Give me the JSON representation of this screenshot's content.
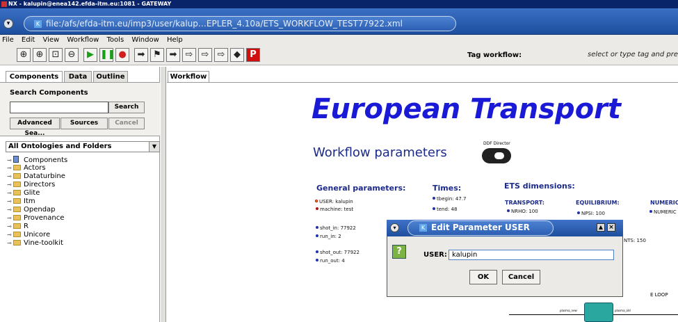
{
  "window": {
    "title": "NX - kalupin@enea142.efda-itm.eu:1081 - GATEWAY"
  },
  "address": {
    "k_badge": "K",
    "path": "file:/afs/efda-itm.eu/imp3/user/kalup…EPLER_4.10a/ETS_WORKFLOW_TEST77922.xml"
  },
  "menu": [
    "File",
    "Edit",
    "View",
    "Workflow",
    "Tools",
    "Window",
    "Help"
  ],
  "toolbar": {
    "buttons": [
      "zoom-in-icon",
      "zoom-reset-icon",
      "zoom-fit-icon",
      "zoom-out-icon",
      "run-icon",
      "pause-icon",
      "stop-icon",
      "arrow-right-icon",
      "flag-icon",
      "arrow-right-bar-icon",
      "outline-arrow-icon",
      "outline-arrow-2-icon",
      "outline-arrow-3-icon",
      "diamond-icon",
      "p-icon"
    ],
    "glyphs": [
      "⊕",
      "⊕",
      "⊡",
      "⊖",
      "▶",
      "❚❚",
      "●",
      "➡",
      "⚑",
      "➡",
      "⇨",
      "⇨",
      "⇨",
      "◆",
      "P"
    ],
    "tag_label": "Tag workflow:",
    "tag_placeholder": "select or type tag and press"
  },
  "left_tabs": [
    "Components",
    "Data",
    "Outline"
  ],
  "search": {
    "title": "Search Components",
    "search_btn": "Search",
    "advanced_btn": "Advanced Sea...",
    "sources_btn": "Sources",
    "cancel_btn": "Cancel"
  },
  "ontology_select": "All Ontologies and Folders",
  "tree": [
    "Components",
    "Actors",
    "Dataturbine",
    "Directors",
    "Glite",
    "Itm",
    "Opendap",
    "Provenance",
    "R",
    "Unicore",
    "Vine-toolkit"
  ],
  "workflow_tab": "Workflow",
  "canvas": {
    "title": "European Transport",
    "params_title": "Workflow parameters",
    "ddf_label": "DDF Director",
    "general_head": "General parameters:",
    "times_head": "Times:",
    "ets_head": "ETS dimensions:",
    "transport_head": "TRANSPORT:",
    "equilibrium_head": "EQUILIBRIUM:",
    "numeric_head": "NUMERIC",
    "general_items": [
      "USER: kalupin",
      "machine: test",
      "shot_in: 77922",
      "run_in: 2",
      "shot_out: 77922",
      "run_out: 4"
    ],
    "times_items": [
      "tbegin: 47.7",
      "tend: 48"
    ],
    "transport_items": [
      "NRHO: 100"
    ],
    "equilibrium_items": [
      "NPSI: 100"
    ],
    "numeric_items": [
      "NUMERIC"
    ],
    "nts_partial": "NTS: 150",
    "loop_label": "E LOOP",
    "plasma_new": "plasma_new",
    "plasma_old": "plasma_old"
  },
  "dialog": {
    "k_badge": "K",
    "title": "Edit Parameter USER",
    "help_glyph": "?",
    "field_label": "USER:",
    "field_value": "kalupin",
    "ok": "OK",
    "cancel": "Cancel"
  }
}
